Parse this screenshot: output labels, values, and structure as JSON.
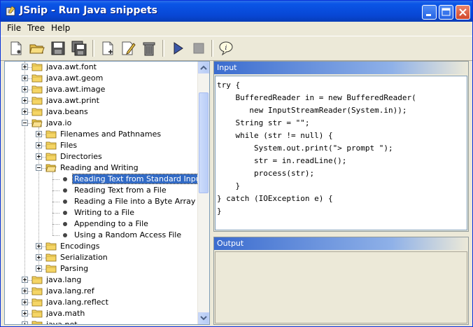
{
  "window": {
    "title": "JSnip - Run Java snippets"
  },
  "menu": [
    "File",
    "Tree",
    "Help"
  ],
  "toolbar": {
    "icons": [
      "new-snippet-icon",
      "open-folder-icon",
      "save-icon",
      "save-all-icon",
      "new-file-icon",
      "edit-icon",
      "trash-icon",
      "run-icon",
      "stop-icon",
      "info-balloon-icon"
    ]
  },
  "tree": {
    "items": [
      {
        "label": "java.awt.font",
        "level": 0,
        "type": "folder",
        "expanded": false
      },
      {
        "label": "java.awt.geom",
        "level": 0,
        "type": "folder",
        "expanded": false
      },
      {
        "label": "java.awt.image",
        "level": 0,
        "type": "folder",
        "expanded": false
      },
      {
        "label": "java.awt.print",
        "level": 0,
        "type": "folder",
        "expanded": false
      },
      {
        "label": "java.beans",
        "level": 0,
        "type": "folder",
        "expanded": false
      },
      {
        "label": "java.io",
        "level": 0,
        "type": "folder",
        "expanded": true
      },
      {
        "label": "Filenames and Pathnames",
        "level": 1,
        "type": "folder",
        "expanded": false
      },
      {
        "label": "Files",
        "level": 1,
        "type": "folder",
        "expanded": false
      },
      {
        "label": "Directories",
        "level": 1,
        "type": "folder",
        "expanded": false
      },
      {
        "label": "Reading and Writing",
        "level": 1,
        "type": "folder",
        "expanded": true
      },
      {
        "label": "Reading Text from Standard Input",
        "level": 2,
        "type": "leaf",
        "selected": true
      },
      {
        "label": "Reading Text from a File",
        "level": 2,
        "type": "leaf"
      },
      {
        "label": "Reading a File into a Byte Array",
        "level": 2,
        "type": "leaf"
      },
      {
        "label": "Writing to a File",
        "level": 2,
        "type": "leaf"
      },
      {
        "label": "Appending to a File",
        "level": 2,
        "type": "leaf"
      },
      {
        "label": "Using a Random Access File",
        "level": 2,
        "type": "leaf"
      },
      {
        "label": "Encodings",
        "level": 1,
        "type": "folder",
        "expanded": false
      },
      {
        "label": "Serialization",
        "level": 1,
        "type": "folder",
        "expanded": false
      },
      {
        "label": "Parsing",
        "level": 1,
        "type": "folder",
        "expanded": false
      },
      {
        "label": "java.lang",
        "level": 0,
        "type": "folder",
        "expanded": false
      },
      {
        "label": "java.lang.ref",
        "level": 0,
        "type": "folder",
        "expanded": false
      },
      {
        "label": "java.lang.reflect",
        "level": 0,
        "type": "folder",
        "expanded": false
      },
      {
        "label": "java.math",
        "level": 0,
        "type": "folder",
        "expanded": false
      },
      {
        "label": "java.net",
        "level": 0,
        "type": "folder",
        "expanded": false
      }
    ]
  },
  "input_panel": {
    "title": "Input",
    "code": "try {\n    BufferedReader in = new BufferedReader(\n       new InputStreamReader(System.in));\n    String str = \"\";\n    while (str != null) {\n        System.out.print(\"> prompt \");\n        str = in.readLine();\n        process(str);\n    }\n} catch (IOException e) {\n}"
  },
  "output_panel": {
    "title": "Output",
    "content": ""
  }
}
